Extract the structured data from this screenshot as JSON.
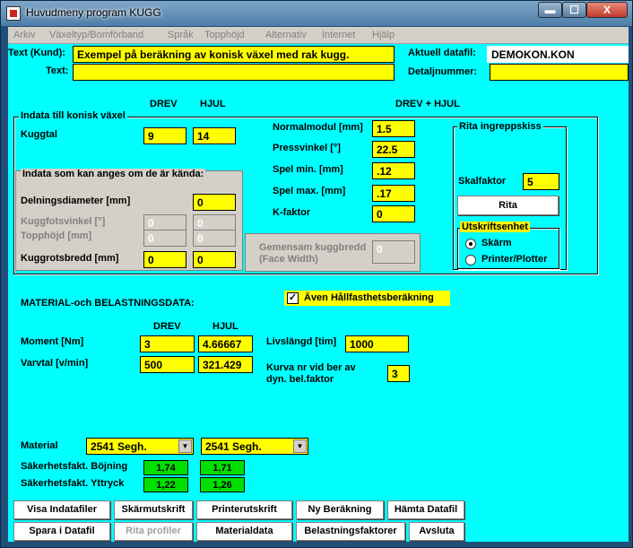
{
  "window": {
    "title": "Huvudmeny program KUGG",
    "minimize_glyph": "▬",
    "maximize_glyph": "☐",
    "close_glyph": "X"
  },
  "menu": [
    "Arkiv",
    "Växeltyp/Bomförband",
    "Språk",
    "Topphöjd",
    "Alternativ",
    "Internet",
    "Hjälp"
  ],
  "header": {
    "text_kund_label": "Text (Kund):",
    "text_kund_value": "Exempel på beräkning av konisk växel med rak kugg.",
    "text_label": "Text:",
    "text_value": "",
    "datafil_label": "Aktuell datafil:",
    "datafil_value": "DEMOKON.KON",
    "detaljnummer_label": "Detaljnummer:",
    "detaljnummer_value": ""
  },
  "columns": {
    "drev": "DREV",
    "hjul": "HJUL",
    "drev_hjul": "DREV + HJUL"
  },
  "indata": {
    "frame_title": "Indata till konisk växel",
    "kuggtal_label": "Kuggtal",
    "kuggtal_drev": "9",
    "kuggtal_hjul": "14",
    "optional_frame_title": "Indata som kan anges om de är kända:",
    "delningsdiameter_label": "Delningsdiameter [mm]",
    "delningsdiameter_value": "0",
    "kuggfotsvinkel_label": "Kuggfotsvinkel [°]",
    "kuggfotsvinkel_drev": "0",
    "kuggfotsvinkel_hjul": "0",
    "topphojd_label": "Topphöjd [mm]",
    "topphojd_drev": "0",
    "topphojd_hjul": "0",
    "kuggrotsbredd_label": "Kuggrotsbredd [mm]",
    "kuggrotsbredd_drev": "0",
    "kuggrotsbredd_hjul": "0",
    "normalmodul_label": "Normalmodul [mm]",
    "normalmodul_value": "1.5",
    "pressvinkel_label": "Pressvinkel [°]",
    "pressvinkel_value": "22.5",
    "spel_min_label": "Spel min. [mm]",
    "spel_min_value": ".12",
    "spel_max_label": "Spel max. [mm]",
    "spel_max_value": ".17",
    "k_faktor_label": "K-faktor",
    "k_faktor_value": "0",
    "face_width_label_1": "Gemensam kuggbredd",
    "face_width_label_2": "(Face Width)",
    "face_width_value": "0"
  },
  "rita": {
    "frame_title": "Rita ingreppskiss",
    "skalfaktor_label": "Skalfaktor",
    "skalfaktor_value": "5",
    "rita_button": "Rita",
    "utskrift_title": "Utskriftsenhet",
    "skarm_label": "Skärm",
    "printer_label": "Printer/Plotter",
    "selected": "Skärm"
  },
  "material_section": {
    "title": "MATERIAL-och BELASTNINGSDATA:",
    "hallfasthet_label": "Även Hållfasthetsberäkning",
    "hallfasthet_checked": "✓",
    "moment_label": "Moment [Nm]",
    "moment_drev": "3",
    "moment_hjul": "4.66667",
    "varvtal_label": "Varvtal [v/min]",
    "varvtal_drev": "500",
    "varvtal_hjul": "321.429",
    "livslangd_label": "Livslängd [tim]",
    "livslangd_value": "1000",
    "kurva_label_1": "Kurva nr vid ber av",
    "kurva_label_2": "dyn. bel.faktor",
    "kurva_value": "3",
    "material_label": "Material",
    "material_drev": "2541 Segh.",
    "material_hjul": "2541 Segh.",
    "sak_bojning_label": "Säkerhetsfakt. Böjning",
    "sak_bojning_drev": "1,74",
    "sak_bojning_hjul": "1,71",
    "sak_yttryck_label": "Säkerhetsfakt. Yttryck",
    "sak_yttryck_drev": "1,22",
    "sak_yttryck_hjul": "1,26",
    "dropdown_glyph": "▼"
  },
  "buttons": {
    "visa_indatafiler": "Visa Indatafiler",
    "skarmutskrift": "Skärmutskrift",
    "printerutskrift": "Printerutskrift",
    "ny_berakning": "Ny Beräkning",
    "hamta_datafil": "Hämta Datafil",
    "spara_i_datafil": "Spara i Datafil",
    "rita_profiler": "Rita profiler",
    "materialdata": "Materialdata",
    "belastningsfaktorer": "Belastningsfaktorer",
    "avsluta": "Avsluta"
  }
}
